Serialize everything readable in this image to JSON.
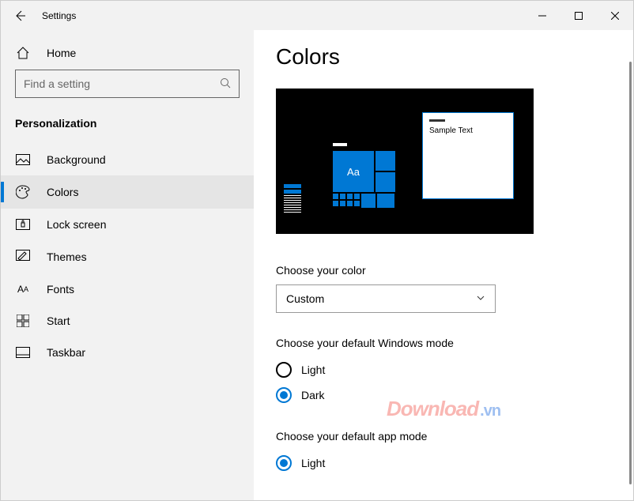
{
  "titlebar": {
    "title": "Settings"
  },
  "sidebar": {
    "home_label": "Home",
    "search_placeholder": "Find a setting",
    "category_label": "Personalization",
    "items": [
      {
        "label": "Background"
      },
      {
        "label": "Colors"
      },
      {
        "label": "Lock screen"
      },
      {
        "label": "Themes"
      },
      {
        "label": "Fonts"
      },
      {
        "label": "Start"
      },
      {
        "label": "Taskbar"
      }
    ]
  },
  "page": {
    "title": "Colors",
    "preview_sample_text": "Sample Text",
    "preview_tile_text": "Aa",
    "choose_color_label": "Choose your color",
    "choose_color_value": "Custom",
    "windows_mode_label": "Choose your default Windows mode",
    "windows_mode_options": {
      "light": "Light",
      "dark": "Dark"
    },
    "app_mode_label": "Choose your default app mode",
    "app_mode_options": {
      "light": "Light"
    }
  },
  "watermark": {
    "main": "Download",
    "suffix": ".vn"
  },
  "colors": {
    "accent": "#0078d4"
  }
}
